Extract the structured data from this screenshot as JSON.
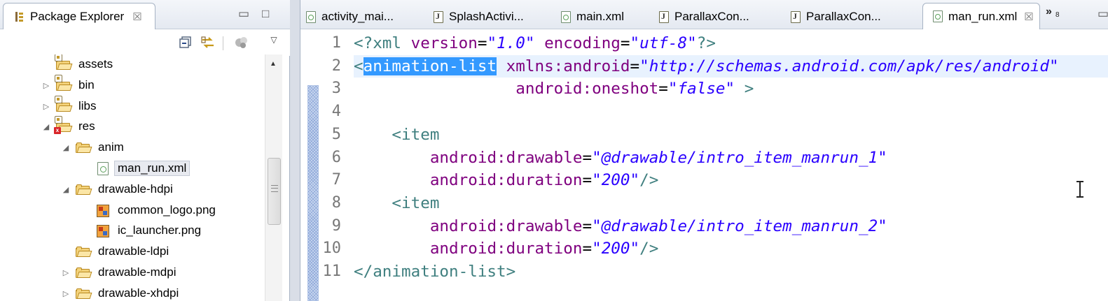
{
  "explorer": {
    "title": "Package Explorer",
    "close_glyph": "☒",
    "minimize_glyph": "▭",
    "maximize_glyph": "□",
    "toolbar": {
      "collapse_all_icon": "collapse-all-icon",
      "link_editor_icon": "link-with-editor-icon",
      "filters_icon": "filters-icon",
      "view_menu_icon": "view-menu-icon"
    },
    "tree": [
      {
        "label": "assets",
        "indent": 0,
        "twisty": "",
        "icon": "package-folder"
      },
      {
        "label": "bin",
        "indent": 0,
        "twisty": "▷",
        "icon": "package-folder"
      },
      {
        "label": "libs",
        "indent": 0,
        "twisty": "▷",
        "icon": "package-folder"
      },
      {
        "label": "res",
        "indent": 0,
        "twisty": "◢",
        "icon": "package-folder-error"
      },
      {
        "label": "anim",
        "indent": 1,
        "twisty": "◢",
        "icon": "folder"
      },
      {
        "label": "man_run.xml",
        "indent": 2,
        "twisty": "",
        "icon": "xml-file",
        "selected": true
      },
      {
        "label": "drawable-hdpi",
        "indent": 1,
        "twisty": "◢",
        "icon": "folder"
      },
      {
        "label": "common_logo.png",
        "indent": 2,
        "twisty": "",
        "icon": "png-file"
      },
      {
        "label": "ic_launcher.png",
        "indent": 2,
        "twisty": "",
        "icon": "png-file"
      },
      {
        "label": "drawable-ldpi",
        "indent": 1,
        "twisty": "",
        "icon": "folder"
      },
      {
        "label": "drawable-mdpi",
        "indent": 1,
        "twisty": "▷",
        "icon": "folder"
      },
      {
        "label": "drawable-xhdpi",
        "indent": 1,
        "twisty": "▷",
        "icon": "folder"
      }
    ]
  },
  "editor": {
    "tabs": [
      {
        "label": "activity_mai...",
        "type": "xml"
      },
      {
        "label": "SplashActivi...",
        "type": "java"
      },
      {
        "label": "main.xml",
        "type": "xml"
      },
      {
        "label": "ParallaxCon...",
        "type": "java"
      },
      {
        "label": "ParallaxCon...",
        "type": "java"
      },
      {
        "label": "man_run.xml",
        "type": "xml",
        "active": true
      }
    ],
    "overflow_glyph": "»",
    "overflow_count": "8",
    "line_numbers": [
      "1",
      "2",
      "3",
      "4",
      "5",
      "6",
      "7",
      "8",
      "9",
      "10",
      "11"
    ],
    "current_line": 2,
    "code": [
      [
        {
          "t": "pi",
          "v": "<?xml "
        },
        {
          "t": "attr",
          "v": "version"
        },
        {
          "t": "plain",
          "v": "="
        },
        {
          "t": "str",
          "v": "\"1.0\""
        },
        {
          "t": "plain",
          "v": " "
        },
        {
          "t": "attr",
          "v": "encoding"
        },
        {
          "t": "plain",
          "v": "="
        },
        {
          "t": "str",
          "v": "\"utf-8\""
        },
        {
          "t": "pi",
          "v": "?>"
        }
      ],
      [
        {
          "t": "tag",
          "v": "<"
        },
        {
          "t": "sel",
          "v": "animation-list"
        },
        {
          "t": "plain",
          "v": " "
        },
        {
          "t": "attr",
          "v": "xmlns:android"
        },
        {
          "t": "plain",
          "v": "="
        },
        {
          "t": "str",
          "v": "\"http://schemas.android.com/apk/res/android\""
        }
      ],
      [
        {
          "t": "plain",
          "v": "                 "
        },
        {
          "t": "attr",
          "v": "android:oneshot"
        },
        {
          "t": "plain",
          "v": "="
        },
        {
          "t": "str",
          "v": "\"false\""
        },
        {
          "t": "plain",
          "v": " "
        },
        {
          "t": "tag",
          "v": ">"
        }
      ],
      [],
      [
        {
          "t": "plain",
          "v": "    "
        },
        {
          "t": "tag",
          "v": "<item"
        }
      ],
      [
        {
          "t": "plain",
          "v": "        "
        },
        {
          "t": "attr",
          "v": "android:drawable"
        },
        {
          "t": "plain",
          "v": "="
        },
        {
          "t": "str",
          "v": "\"@drawable/intro_item_manrun_1\""
        }
      ],
      [
        {
          "t": "plain",
          "v": "        "
        },
        {
          "t": "attr",
          "v": "android:duration"
        },
        {
          "t": "plain",
          "v": "="
        },
        {
          "t": "str",
          "v": "\"200\""
        },
        {
          "t": "tag",
          "v": "/>"
        }
      ],
      [
        {
          "t": "plain",
          "v": "    "
        },
        {
          "t": "tag",
          "v": "<item"
        }
      ],
      [
        {
          "t": "plain",
          "v": "        "
        },
        {
          "t": "attr",
          "v": "android:drawable"
        },
        {
          "t": "plain",
          "v": "="
        },
        {
          "t": "str",
          "v": "\"@drawable/intro_item_manrun_2\""
        }
      ],
      [
        {
          "t": "plain",
          "v": "        "
        },
        {
          "t": "attr",
          "v": "android:duration"
        },
        {
          "t": "plain",
          "v": "="
        },
        {
          "t": "str",
          "v": "\"200\""
        },
        {
          "t": "tag",
          "v": "/>"
        }
      ],
      [
        {
          "t": "tag",
          "v": "</animation-list>"
        }
      ]
    ]
  },
  "colors": {
    "tag": "#3f7f7f",
    "attribute": "#7f007f",
    "string": "#2a00ff",
    "selection": "#3399ff",
    "current_line": "#e8f2fe"
  }
}
